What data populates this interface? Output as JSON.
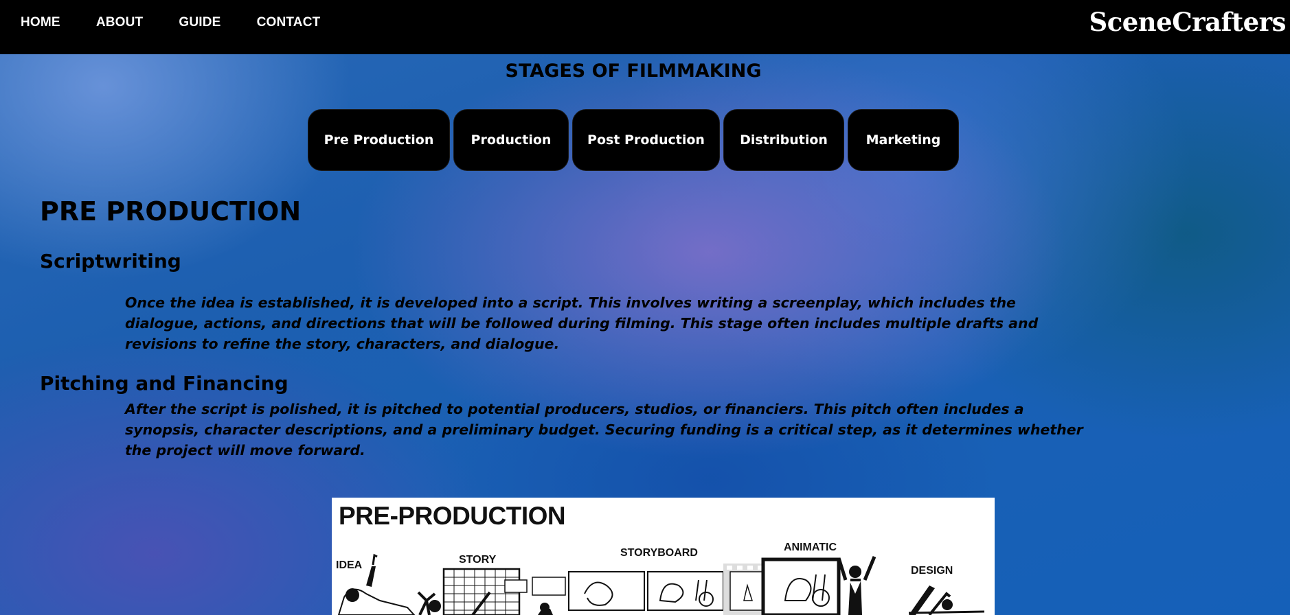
{
  "nav": {
    "links": [
      "HOME",
      "ABOUT",
      "GUIDE",
      "CONTACT"
    ],
    "brand": "SceneCrafters"
  },
  "stages": {
    "title": "STAGES OF FILMMAKING",
    "tabs": [
      "Pre Production",
      "Production",
      "Post Production",
      "Distribution",
      "Marketing"
    ]
  },
  "content": {
    "section_title": "PRE PRODUCTION",
    "subsections": [
      {
        "title": "Scriptwriting",
        "text": "Once the idea is established, it is developed into a script. This involves writing a screenplay, which includes the dialogue, actions, and directions that will be followed during filming. This stage often includes multiple drafts and revisions to refine the story, characters, and dialogue."
      },
      {
        "title": "Pitching and Financing",
        "text": "After the script is polished, it is pitched to potential producers, studios, or financiers. This pitch often includes a synopsis, character descriptions, and a preliminary budget. Securing funding is a critical step, as it determines whether the project will move forward."
      }
    ]
  },
  "figure": {
    "title": "PRE-PRODUCTION",
    "labels": [
      "IDEA",
      "STORY",
      "STORYBOARD",
      "ANIMATIC",
      "DESIGN"
    ]
  }
}
